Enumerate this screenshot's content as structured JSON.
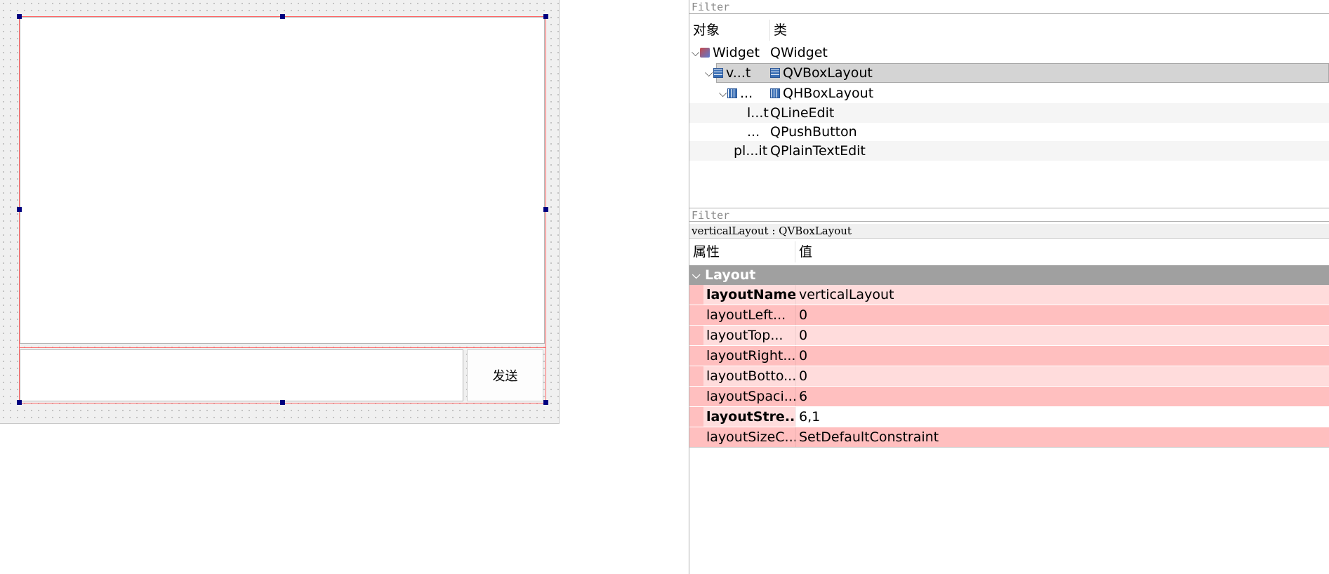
{
  "form": {
    "button_label": "发送",
    "line_edit_value": "",
    "plain_text_value": ""
  },
  "object_inspector": {
    "filter_placeholder": "Filter",
    "columns": [
      "对象",
      "类"
    ],
    "rows": [
      {
        "object": "Widget",
        "class": "QWidget",
        "icon": "widget-icon",
        "expanded": true
      },
      {
        "object": "v...t",
        "class": "QVBoxLayout",
        "icon": "vbox-layout-icon",
        "expanded": true,
        "selected": true
      },
      {
        "object": "...",
        "class": "QHBoxLayout",
        "icon": "hbox-layout-icon",
        "expanded": true
      },
      {
        "object": "l...t",
        "class": "QLineEdit"
      },
      {
        "object": "...",
        "class": "QPushButton"
      },
      {
        "object": "pl...it",
        "class": "QPlainTextEdit"
      }
    ]
  },
  "property_editor": {
    "filter_placeholder": "Filter",
    "object_info": "verticalLayout : QVBoxLayout",
    "columns": [
      "属性",
      "值"
    ],
    "category": "Layout",
    "properties": [
      {
        "name": "layoutName",
        "value": "verticalLayout",
        "bold": true
      },
      {
        "name": "layoutLeft...",
        "value": "0"
      },
      {
        "name": "layoutTop...",
        "value": "0"
      },
      {
        "name": "layoutRight...",
        "value": "0"
      },
      {
        "name": "layoutBotto...",
        "value": "0"
      },
      {
        "name": "layoutSpaci...",
        "value": "6"
      },
      {
        "name": "layoutStre...",
        "value": "6,1",
        "bold": true
      },
      {
        "name": "layoutSizeC...",
        "value": "SetDefaultConstraint"
      }
    ]
  },
  "colors": {
    "selection_outline": "#ff6666",
    "handle": "#000080",
    "category_bg": "#a0a0a0",
    "prop_light": "#ffdcdc",
    "prop_dark": "#ffbfbf"
  }
}
